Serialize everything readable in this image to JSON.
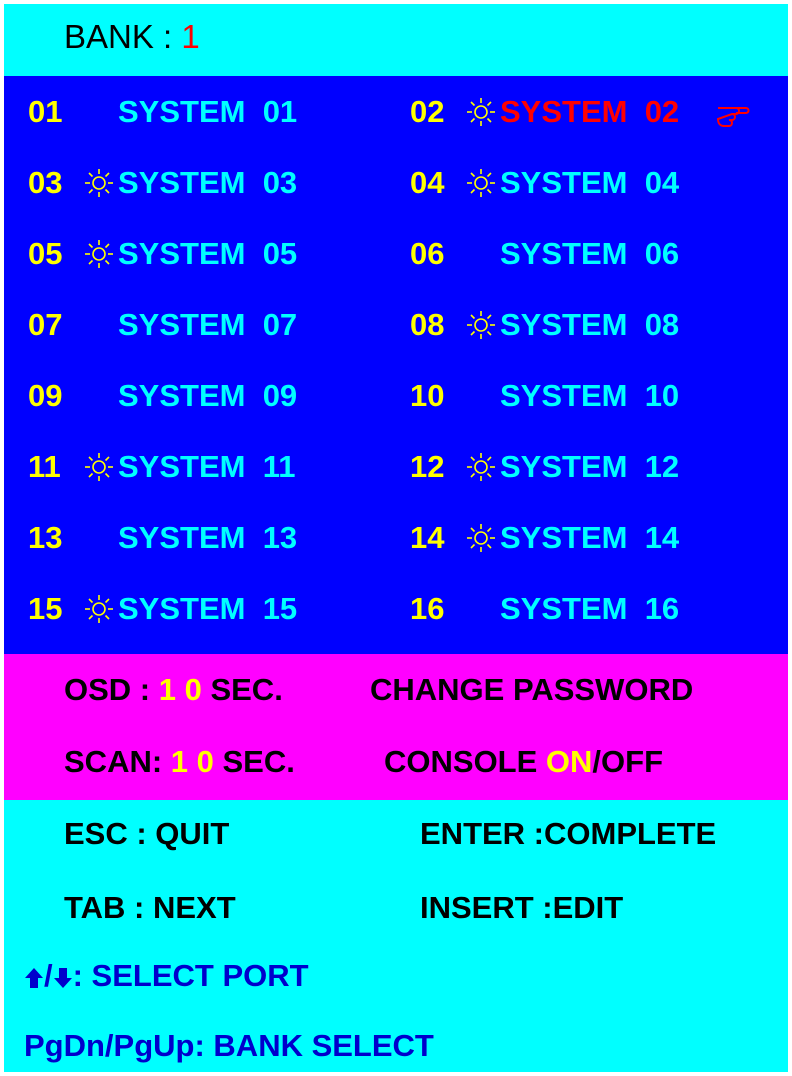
{
  "bank": {
    "label": "BANK : ",
    "number": "1"
  },
  "ports": [
    {
      "num": "01",
      "name": "SYSTEM  01",
      "active": false,
      "selected": false
    },
    {
      "num": "02",
      "name": "SYSTEM  02",
      "active": true,
      "selected": true
    },
    {
      "num": "03",
      "name": "SYSTEM  03",
      "active": true,
      "selected": false
    },
    {
      "num": "04",
      "name": "SYSTEM  04",
      "active": true,
      "selected": false
    },
    {
      "num": "05",
      "name": "SYSTEM  05",
      "active": true,
      "selected": false
    },
    {
      "num": "06",
      "name": "SYSTEM  06",
      "active": false,
      "selected": false
    },
    {
      "num": "07",
      "name": "SYSTEM  07",
      "active": false,
      "selected": false
    },
    {
      "num": "08",
      "name": "SYSTEM  08",
      "active": true,
      "selected": false
    },
    {
      "num": "09",
      "name": "SYSTEM  09",
      "active": false,
      "selected": false
    },
    {
      "num": "10",
      "name": "SYSTEM  10",
      "active": false,
      "selected": false
    },
    {
      "num": "11",
      "name": "SYSTEM  11",
      "active": true,
      "selected": false
    },
    {
      "num": "12",
      "name": "SYSTEM  12",
      "active": true,
      "selected": false
    },
    {
      "num": "13",
      "name": "SYSTEM  13",
      "active": false,
      "selected": false
    },
    {
      "num": "14",
      "name": "SYSTEM  14",
      "active": true,
      "selected": false
    },
    {
      "num": "15",
      "name": "SYSTEM  15",
      "active": true,
      "selected": false
    },
    {
      "num": "16",
      "name": "SYSTEM  16",
      "active": false,
      "selected": false
    }
  ],
  "settings": {
    "osd_label": "OSD : ",
    "osd_value": "1 0",
    "osd_unit": " SEC.",
    "scan_label": "SCAN: ",
    "scan_value": "1 0",
    "scan_unit": " SEC.",
    "change_password": "CHANGE PASSWORD",
    "console_label": "CONSOLE  ",
    "console_on": "ON",
    "console_off": "/OFF"
  },
  "help": {
    "esc": "ESC : QUIT",
    "enter": "ENTER :COMPLETE",
    "tab": "TAB : NEXT",
    "insert": "INSERT :EDIT",
    "select_port": ": SELECT  PORT",
    "bank_select": "PgDn/PgUp: BANK  SELECT"
  },
  "colors": {
    "bank_bar": "#00ffff",
    "ports_bg": "#0000ff",
    "settings_bg": "#ff00ff",
    "help_bg": "#00ffff",
    "port_number": "#ffff00",
    "port_name": "#00ffff",
    "selected": "#ff0000"
  },
  "icons": {
    "active": "sun-icon",
    "selected": "pointing-hand-icon",
    "up": "up-arrow-icon",
    "down": "down-arrow-icon"
  }
}
